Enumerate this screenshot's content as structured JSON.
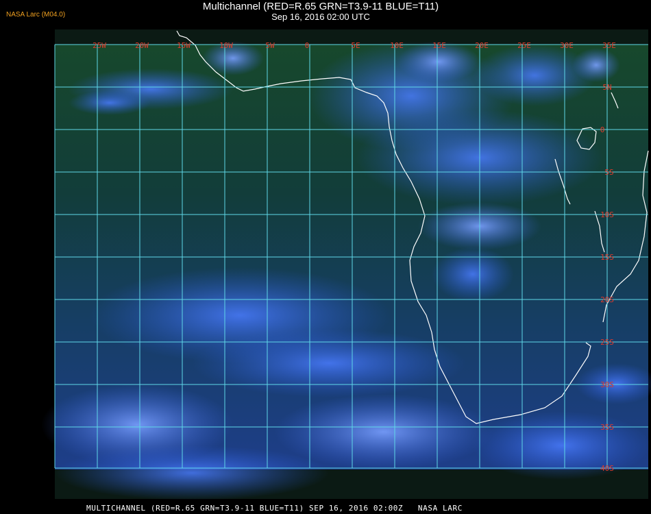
{
  "header": {
    "source_label": "NASA Larc (M04.0)",
    "title": "Multichannel (RED=R.65 GRN=T3.9-11 BLUE=T11)",
    "subtitle": "Sep 16, 2016 02:00 UTC"
  },
  "grid": {
    "longitude_labels": [
      "25W",
      "20W",
      "15W",
      "10W",
      "5W",
      "0",
      "5E",
      "10E",
      "15E",
      "20E",
      "25E",
      "30E",
      "35E"
    ],
    "latitude_labels": [
      "5N",
      "0",
      "5S",
      "10S",
      "15S",
      "20S",
      "25S",
      "30S",
      "35S",
      "40S"
    ]
  },
  "colors": {
    "grid_line": "#5fd8e8",
    "grid_label": "#e03a2a",
    "coastline": "#ffffff",
    "source_label": "#f0a020",
    "ocean_dark": "#0d3a38",
    "cloud_blue": "#3a6ef0"
  },
  "footer": {
    "caption": "MULTICHANNEL (RED=R.65 GRN=T3.9-11 BLUE=T11) SEP 16, 2016 02:00Z   NASA LARC"
  }
}
